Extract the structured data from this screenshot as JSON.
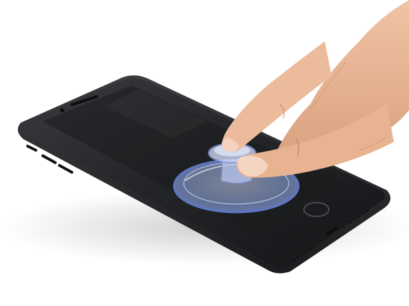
{
  "image": {
    "subject": "phone-with-suction-cup-held-by-hand",
    "background_color": "#ffffff",
    "phone_body_color": "#2b2c2e",
    "phone_screen_color": "#1c1d1f",
    "suction_cup_color": "#9fb4e8",
    "skin_color": "#e9b898"
  },
  "icons": {
    "phone": "phone-icon",
    "suction_cup": "suction-cup-icon",
    "hand": "hand-icon"
  }
}
